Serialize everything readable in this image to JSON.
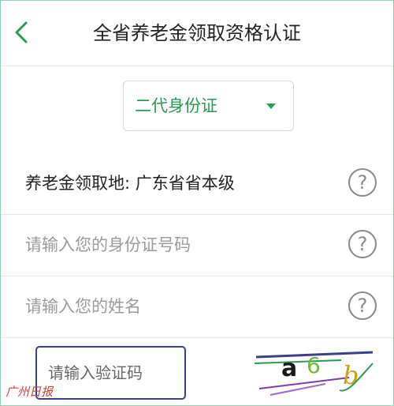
{
  "header": {
    "title": "全省养老金领取资格认证",
    "back_icon": "chevron-left-icon"
  },
  "id_type_select": {
    "value": "二代身份证"
  },
  "rows": {
    "location": {
      "label": "养老金领取地: 广东省省本级",
      "help_icon": "question-circle-icon"
    },
    "id_number": {
      "placeholder": "请输入您的身份证号码",
      "help_icon": "question-circle-icon"
    },
    "name": {
      "placeholder": "请输入您的姓名",
      "help_icon": "question-circle-icon"
    }
  },
  "captcha": {
    "placeholder": "请输入验证码",
    "image_text": "a6b",
    "watermark": "广州日报"
  },
  "colors": {
    "accent": "#2a9a52",
    "border": "#8fd3b6",
    "captcha_border": "#3b3f8a"
  }
}
